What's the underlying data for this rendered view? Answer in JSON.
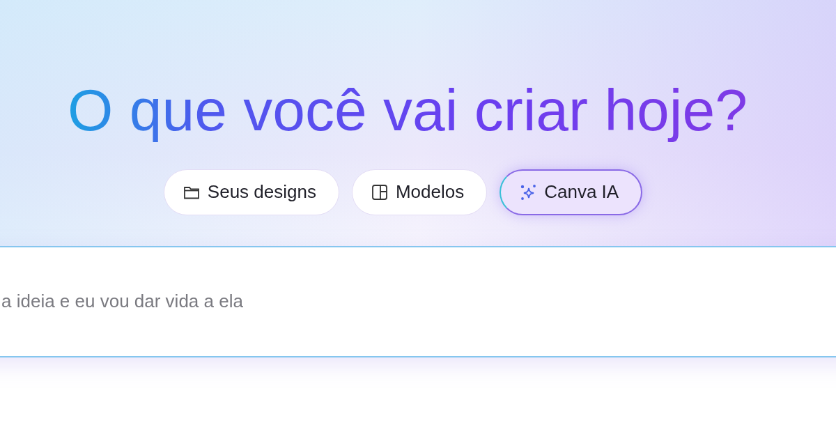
{
  "heading": "O que você vai criar hoje?",
  "tabs": [
    {
      "label": "Seus designs",
      "kind": "folder",
      "selected": false
    },
    {
      "label": "Modelos",
      "kind": "layout",
      "selected": false
    },
    {
      "label": "Canva IA",
      "kind": "sparkle",
      "selected": true
    }
  ],
  "prompt": {
    "placeholder": "a ideia e eu vou dar vida a ela"
  }
}
